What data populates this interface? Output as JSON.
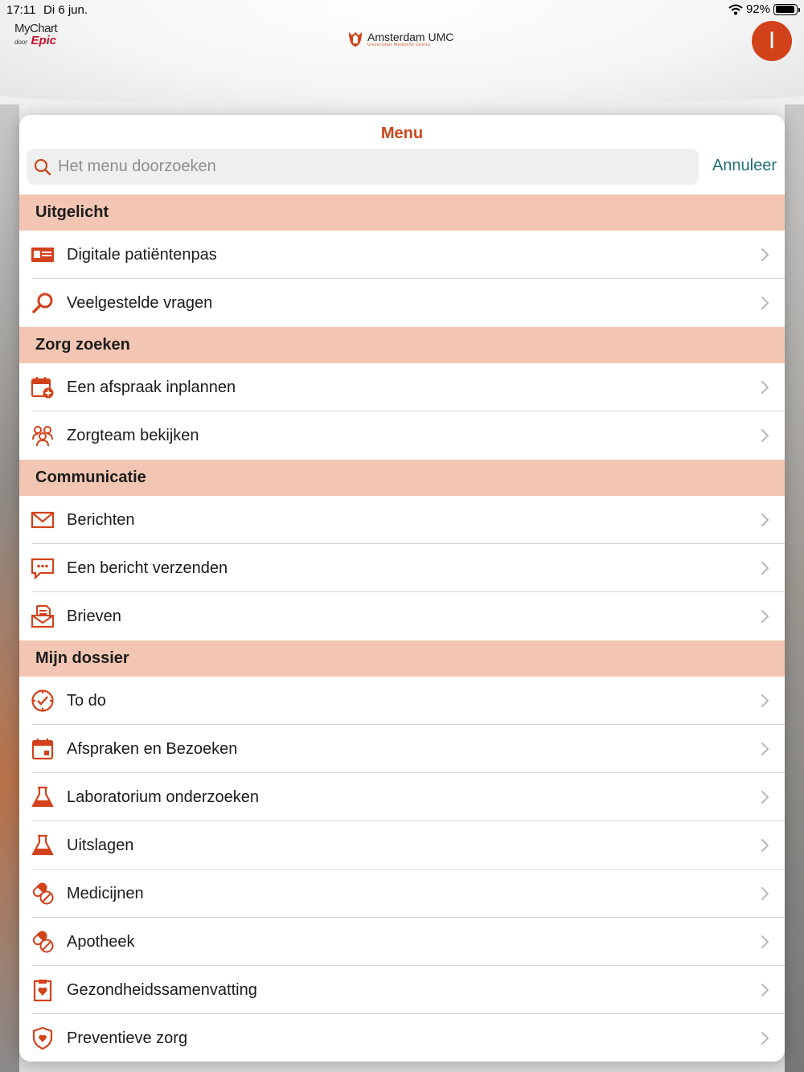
{
  "status_bar": {
    "time": "17:11",
    "date": "Di 6 jun.",
    "battery": "92%",
    "battery_level": 0.92
  },
  "header": {
    "mychart_logo": {
      "line1": "MyChart",
      "door": "door",
      "epic": "Epic"
    },
    "hospital_logo": {
      "name": "Amsterdam UMC",
      "subtitle": "Universitair Medische Centra"
    },
    "avatar_initial": "I"
  },
  "menu": {
    "title": "Menu",
    "search": {
      "placeholder": "Het menu doorzoeken",
      "value": ""
    },
    "cancel_label": "Annuleer",
    "accent_color": "#c9481c",
    "section_color": "#f2c6b2"
  },
  "sections": [
    {
      "title": "Uitgelicht",
      "items": [
        {
          "label": "Digitale patiëntenpas",
          "icon": "id-card-icon"
        },
        {
          "label": "Veelgestelde vragen",
          "icon": "magnifier-icon"
        }
      ]
    },
    {
      "title": "Zorg zoeken",
      "items": [
        {
          "label": "Een afspraak inplannen",
          "icon": "calendar-add-icon"
        },
        {
          "label": "Zorgteam bekijken",
          "icon": "care-team-icon"
        }
      ]
    },
    {
      "title": "Communicatie",
      "items": [
        {
          "label": "Berichten",
          "icon": "envelope-icon"
        },
        {
          "label": "Een bericht verzenden",
          "icon": "chat-bubble-icon"
        },
        {
          "label": "Brieven",
          "icon": "letter-icon"
        }
      ]
    },
    {
      "title": "Mijn dossier",
      "items": [
        {
          "label": "To do",
          "icon": "checklist-clock-icon"
        },
        {
          "label": "Afspraken en Bezoeken",
          "icon": "calendar-icon"
        },
        {
          "label": "Laboratorium onderzoeken",
          "icon": "flask-icon"
        },
        {
          "label": "Uitslagen",
          "icon": "flask-icon"
        },
        {
          "label": "Medicijnen",
          "icon": "pills-icon"
        },
        {
          "label": "Apotheek",
          "icon": "pills-icon"
        },
        {
          "label": "Gezondheidssamenvatting",
          "icon": "clipboard-heart-icon"
        },
        {
          "label": "Preventieve zorg",
          "icon": "shield-heart-icon"
        }
      ]
    }
  ]
}
